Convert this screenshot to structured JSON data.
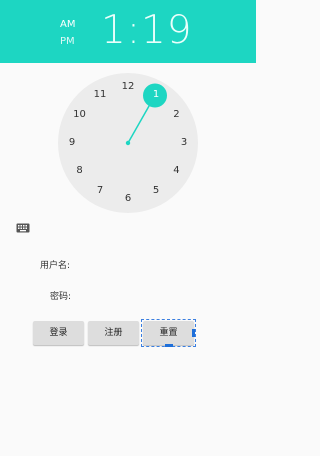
{
  "header": {
    "am_label": "AM",
    "pm_label": "PM",
    "time": "1:19"
  },
  "clock": {
    "numbers": [
      "12",
      "1",
      "2",
      "3",
      "4",
      "5",
      "6",
      "7",
      "8",
      "9",
      "10",
      "11"
    ],
    "selected_hour": "1",
    "accent_color": "#1dd6c2"
  },
  "form": {
    "keyboard_icon": "keyboard-icon",
    "username_label": "用户名:",
    "password_label": "密码:",
    "login_button": "登录",
    "register_button": "注册",
    "reset_button": "重置"
  },
  "colors": {
    "header_bg": "#1dd6c2",
    "clock_face": "#ececec",
    "button_bg": "#dddddd",
    "focus_outline": "#3b7fe0"
  }
}
